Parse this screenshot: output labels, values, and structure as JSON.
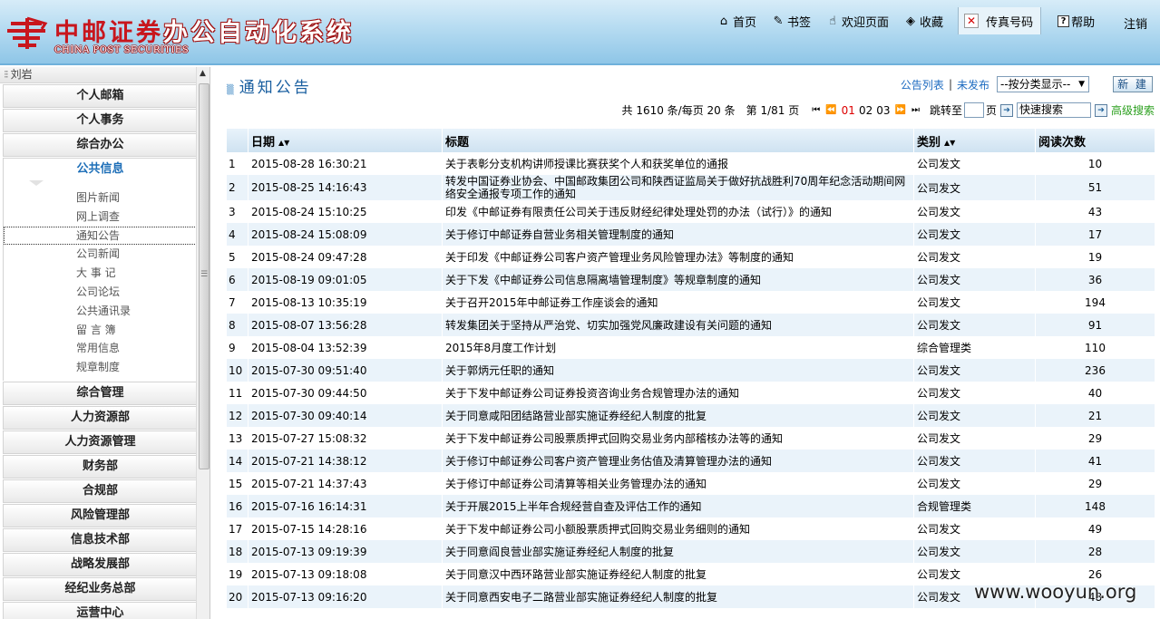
{
  "header": {
    "logo_cn_red": "中邮证券",
    "logo_cn_rest": "办公自动化系统",
    "logo_en": "CHINA POST SECURITIES",
    "nav": {
      "home": "首页",
      "bookmark": "书签",
      "welcome": "欢迎页面",
      "favorites": "收藏",
      "fax": "传真号码",
      "help": "帮助"
    },
    "logout": "注销"
  },
  "sidebar": {
    "user": "刘岩",
    "menu_top": [
      "个人邮箱",
      "个人事务",
      "综合办公"
    ],
    "active_menu": "公共信息",
    "submenu": [
      "图片新闻",
      "网上调查",
      "通知公告",
      "公司新闻",
      "大 事 记",
      "公司论坛",
      "公共通讯录",
      "留 言 簿",
      "常用信息",
      "规章制度"
    ],
    "current_sub": "通知公告",
    "menu_bottom": [
      "综合管理",
      "人力资源部",
      "人力资源管理",
      "财务部",
      "合规部",
      "风险管理部",
      "信息技术部",
      "战略发展部",
      "经纪业务总部",
      "运营中心"
    ]
  },
  "main": {
    "title": "通知公告",
    "list_link": "公告列表",
    "unpublished_link": "未发布",
    "category_select": "--按分类显示--",
    "new_button": "新 建",
    "pager": {
      "summary": "共 1610 条/每页 20 条",
      "page_info": "第 1/81 页",
      "pages": [
        "01",
        "02",
        "03"
      ],
      "current_page": "01",
      "jump_label": "跳转至",
      "jump_unit": "页",
      "search_placeholder": "快速搜索",
      "advanced_search": "高级搜索"
    },
    "columns": [
      "日期",
      "标题",
      "类别",
      "阅读次数"
    ],
    "rows": [
      {
        "n": "1",
        "date": "2015-08-28 16:30:21",
        "title": "关于表彰分支机构讲师授课比赛获奖个人和获奖单位的通报",
        "cat": "公司发文",
        "reads": "10"
      },
      {
        "n": "2",
        "date": "2015-08-25 14:16:43",
        "title": "转发中国证券业协会、中国邮政集团公司和陕西证监局关于做好抗战胜利70周年纪念活动期间网络安全通报专项工作的通知",
        "cat": "公司发文",
        "reads": "51"
      },
      {
        "n": "3",
        "date": "2015-08-24 15:10:25",
        "title": "印发《中邮证券有限责任公司关于违反财经纪律处理处罚的办法（试行）》的通知",
        "cat": "公司发文",
        "reads": "43"
      },
      {
        "n": "4",
        "date": "2015-08-24 15:08:09",
        "title": "关于修订中邮证券自营业务相关管理制度的通知",
        "cat": "公司发文",
        "reads": "17"
      },
      {
        "n": "5",
        "date": "2015-08-24 09:47:28",
        "title": "关于印发《中邮证券公司客户资产管理业务风险管理办法》等制度的通知",
        "cat": "公司发文",
        "reads": "19"
      },
      {
        "n": "6",
        "date": "2015-08-19 09:01:05",
        "title": "关于下发《中邮证券公司信息隔离墙管理制度》等规章制度的通知",
        "cat": "公司发文",
        "reads": "36"
      },
      {
        "n": "7",
        "date": "2015-08-13 10:35:19",
        "title": "关于召开2015年中邮证券工作座谈会的通知",
        "cat": "公司发文",
        "reads": "194"
      },
      {
        "n": "8",
        "date": "2015-08-07 13:56:28",
        "title": "转发集团关于坚持从严治党、切实加强党风廉政建设有关问题的通知",
        "cat": "公司发文",
        "reads": "91"
      },
      {
        "n": "9",
        "date": "2015-08-04 13:52:39",
        "title": "2015年8月度工作计划",
        "cat": "综合管理类",
        "reads": "110"
      },
      {
        "n": "10",
        "date": "2015-07-30 09:51:40",
        "title": "关于郭炳元任职的通知",
        "cat": "公司发文",
        "reads": "236"
      },
      {
        "n": "11",
        "date": "2015-07-30 09:44:50",
        "title": "关于下发中邮证券公司证券投资咨询业务合规管理办法的通知",
        "cat": "公司发文",
        "reads": "40"
      },
      {
        "n": "12",
        "date": "2015-07-30 09:40:14",
        "title": "关于同意咸阳团结路营业部实施证券经纪人制度的批复",
        "cat": "公司发文",
        "reads": "21"
      },
      {
        "n": "13",
        "date": "2015-07-27 15:08:32",
        "title": "关于下发中邮证券公司股票质押式回购交易业务内部稽核办法等的通知",
        "cat": "公司发文",
        "reads": "29"
      },
      {
        "n": "14",
        "date": "2015-07-21 14:38:12",
        "title": "关于修订中邮证券公司客户资产管理业务估值及清算管理办法的通知",
        "cat": "公司发文",
        "reads": "41"
      },
      {
        "n": "15",
        "date": "2015-07-21 14:37:43",
        "title": "关于修订中邮证券公司清算等相关业务管理办法的通知",
        "cat": "公司发文",
        "reads": "29"
      },
      {
        "n": "16",
        "date": "2015-07-16 16:14:31",
        "title": "关于开展2015上半年合规经营自查及评估工作的通知",
        "cat": "合规管理类",
        "reads": "148"
      },
      {
        "n": "17",
        "date": "2015-07-15 14:28:16",
        "title": "关于下发中邮证券公司小额股票质押式回购交易业务细则的通知",
        "cat": "公司发文",
        "reads": "49"
      },
      {
        "n": "18",
        "date": "2015-07-13 09:19:39",
        "title": "关于同意阎良营业部实施证券经纪人制度的批复",
        "cat": "公司发文",
        "reads": "28"
      },
      {
        "n": "19",
        "date": "2015-07-13 09:18:08",
        "title": "关于同意汉中西环路营业部实施证券经纪人制度的批复",
        "cat": "公司发文",
        "reads": "26"
      },
      {
        "n": "20",
        "date": "2015-07-13 09:16:20",
        "title": "关于同意西安电子二路营业部实施证券经纪人制度的批复",
        "cat": "公司发文",
        "reads": "48"
      }
    ]
  },
  "watermark": "www.wooyun.org",
  "colors": {
    "accent": "#1a5fa0",
    "link": "#1d6bc0",
    "current_page": "#dd0000",
    "advanced": "#2ca01f",
    "logo_red": "#c8161d"
  }
}
